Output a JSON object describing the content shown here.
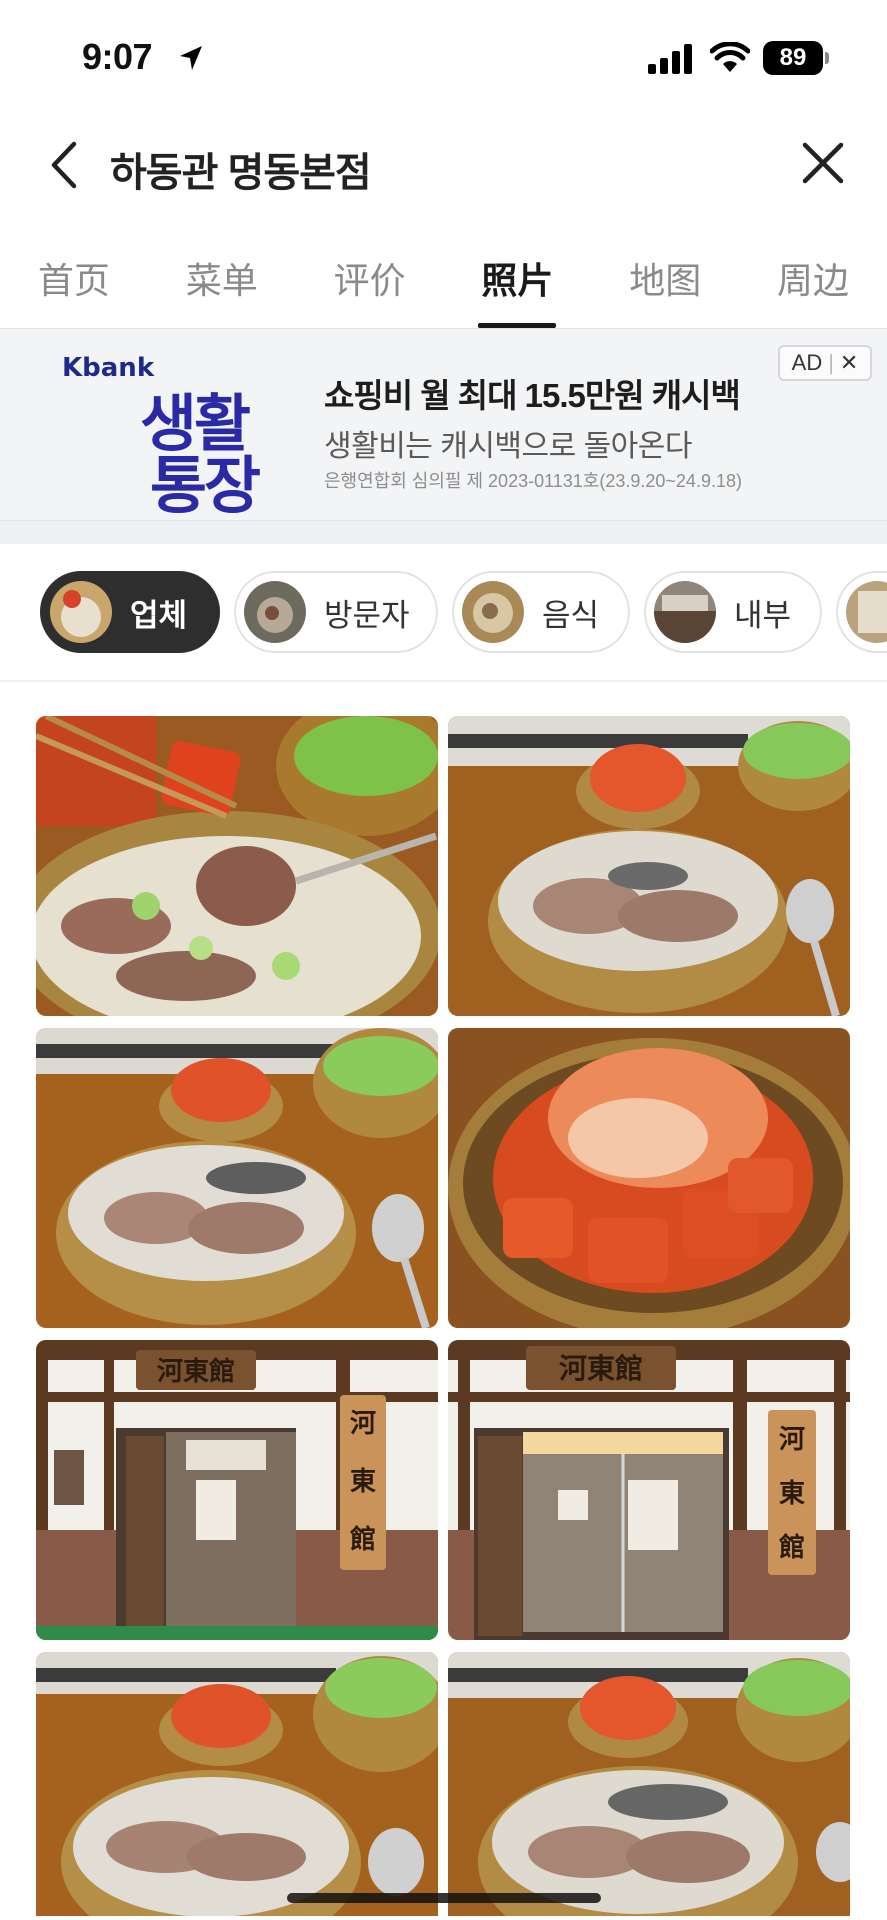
{
  "status_bar": {
    "time": "9:07",
    "battery": "89"
  },
  "header": {
    "title": "하동관 명동본점"
  },
  "tabs": [
    {
      "label": "首页",
      "active": false
    },
    {
      "label": "菜单",
      "active": false
    },
    {
      "label": "评价",
      "active": false
    },
    {
      "label": "照片",
      "active": true
    },
    {
      "label": "地图",
      "active": false
    },
    {
      "label": "周边",
      "active": false
    }
  ],
  "ad": {
    "brand": "Kbank",
    "logo_line1": "생활",
    "logo_line2": "통장",
    "headline": "쇼핑비 월 최대 15.5만원 캐시백",
    "subline": "생활비는 캐시백으로 돌아온다",
    "note": "은행연합회 심의필 제 2023-01131호(23.9.20~24.9.18)",
    "badge": "AD",
    "badge_close": "✕"
  },
  "filters": [
    {
      "label": "업체",
      "active": true
    },
    {
      "label": "방문자",
      "active": false
    },
    {
      "label": "음식",
      "active": false
    },
    {
      "label": "내부",
      "active": false
    }
  ],
  "photos": [
    {
      "subject": "soup-chopsticks-kimchi"
    },
    {
      "subject": "soup-bowl-set"
    },
    {
      "subject": "soup-bowl-set"
    },
    {
      "subject": "kimchi-bowl"
    },
    {
      "subject": "storefront"
    },
    {
      "subject": "storefront"
    },
    {
      "subject": "soup-bowl-set"
    },
    {
      "subject": "soup-bowl-set"
    }
  ],
  "storefront_signs": {
    "top": "河東館",
    "side": [
      "河",
      "東",
      "館"
    ]
  },
  "colors": {
    "accent": "#1a1a1a",
    "ad_brand": "#2b2aa6",
    "ad_bg": "#f3f4f6"
  }
}
